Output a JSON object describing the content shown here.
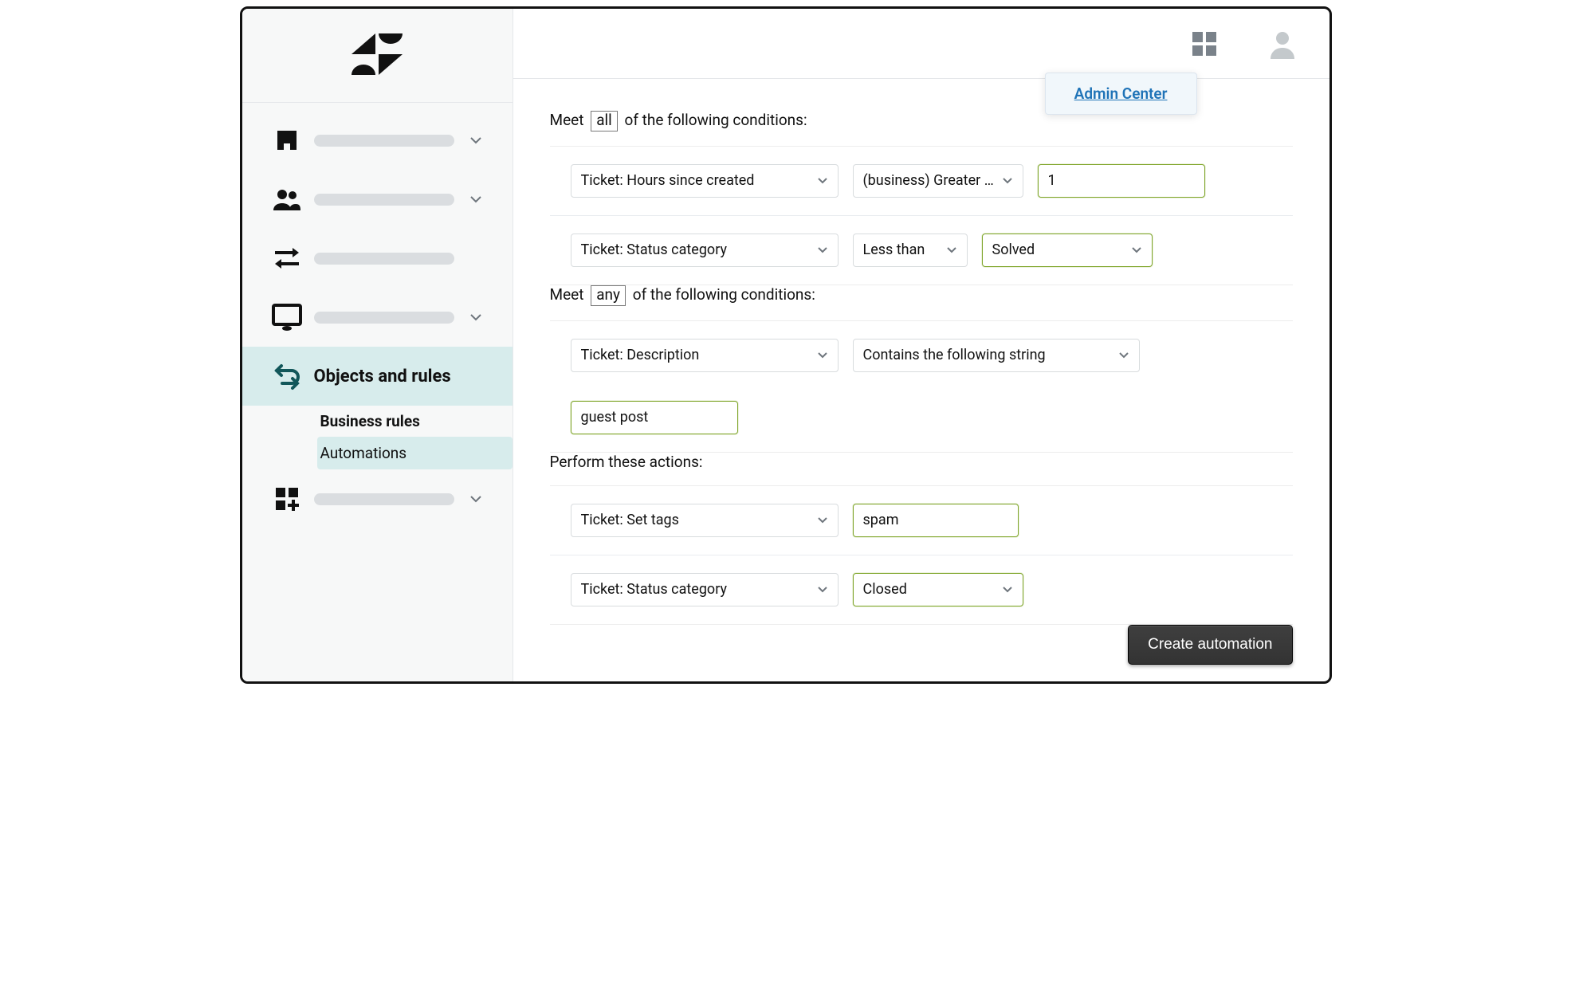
{
  "sidebar": {
    "active_label": "Objects and rules",
    "subgroup_label": "Business rules",
    "sublink_active": "Automations"
  },
  "topbar": {
    "tooltip_label": "Admin Center"
  },
  "conditions_all": {
    "prefix": "Meet",
    "chip": "all",
    "suffix": "of the following conditions:",
    "rows": [
      {
        "field": "Ticket: Hours since created",
        "operator": "(business) Greater than",
        "value": "1"
      },
      {
        "field": "Ticket: Status category",
        "operator": "Less than",
        "value": "Solved"
      }
    ]
  },
  "conditions_any": {
    "prefix": "Meet",
    "chip": "any",
    "suffix": "of the following conditions:",
    "rows": [
      {
        "field": "Ticket: Description",
        "operator": "Contains the following string",
        "value": "guest post"
      }
    ]
  },
  "actions": {
    "title": "Perform these actions:",
    "rows": [
      {
        "field": "Ticket: Set tags",
        "value": "spam"
      },
      {
        "field": "Ticket: Status category",
        "value": "Closed"
      }
    ]
  },
  "footer": {
    "create_label": "Create automation"
  }
}
